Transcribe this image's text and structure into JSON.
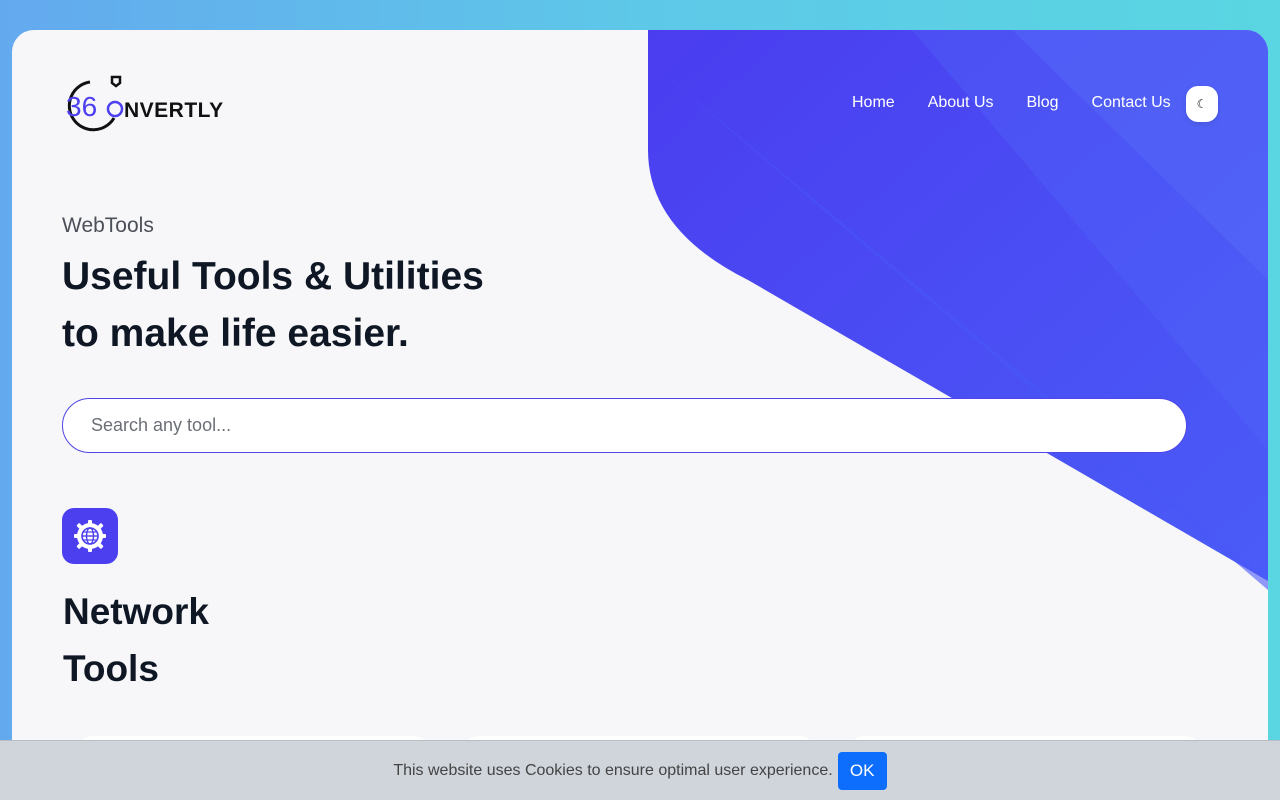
{
  "brand": {
    "logo_text": "NVERTLY",
    "logo_numerals": "36",
    "accent_color": "#4b3ff0"
  },
  "nav": {
    "items": [
      {
        "label": "Home"
      },
      {
        "label": "About Us"
      },
      {
        "label": "Blog"
      },
      {
        "label": "Contact Us"
      }
    ],
    "theme_toggle_icon": "moon-icon"
  },
  "hero": {
    "eyebrow": "WebTools",
    "headline_line1": "Useful Tools & Utilities",
    "headline_line2": "to make life easier."
  },
  "search": {
    "placeholder": "Search any tool...",
    "value": ""
  },
  "category": {
    "icon": "globe-gear-icon",
    "title_line1": "Network",
    "title_line2": "Tools"
  },
  "cookie_banner": {
    "text": "This website uses Cookies to ensure optimal user experience.",
    "ok_label": "OK",
    "ok_color": "#0d6efd"
  }
}
